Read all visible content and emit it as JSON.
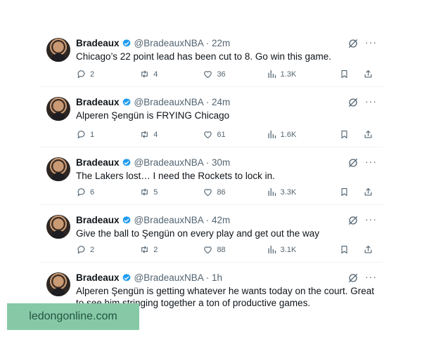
{
  "colors": {
    "verified": "#1d9bf0",
    "muted": "#536471",
    "watermark_bg": "#87c9a7"
  },
  "icons": {
    "reply": "reply-icon",
    "retweet": "retweet-icon",
    "like": "heart-icon",
    "views": "views-icon",
    "bookmark": "bookmark-icon",
    "share": "share-icon",
    "grok": "grok-icon",
    "more": "more-icon",
    "verified": "verified-badge-icon"
  },
  "tweets": [
    {
      "name": "Bradeaux",
      "handle": "@BradeauxNBA",
      "time": "· 22m",
      "text": "Chicago’s 22 point lead has been cut to 8. Go win this game.",
      "replies": "2",
      "retweets": "4",
      "likes": "36",
      "views": "1.3K"
    },
    {
      "name": "Bradeaux",
      "handle": "@BradeauxNBA",
      "time": "· 24m",
      "text": "Alperen Şengün is FRYING Chicago",
      "replies": "1",
      "retweets": "4",
      "likes": "61",
      "views": "1.6K"
    },
    {
      "name": "Bradeaux",
      "handle": "@BradeauxNBA",
      "time": "· 30m",
      "text": "The Lakers lost… I need the Rockets to lock in.",
      "replies": "6",
      "retweets": "5",
      "likes": "86",
      "views": "3.3K"
    },
    {
      "name": "Bradeaux",
      "handle": "@BradeauxNBA",
      "time": "· 42m",
      "text": "Give the ball to Şengün on every play and get out the way",
      "replies": "2",
      "retweets": "2",
      "likes": "88",
      "views": "3.1K"
    },
    {
      "name": "Bradeaux",
      "handle": "@BradeauxNBA",
      "time": "· 1h",
      "text": "Alperen Şengün is getting whatever he wants today on the court. Great to see him stringing together a ton of productive games.",
      "replies": "",
      "retweets": "",
      "likes": "",
      "views": ""
    }
  ],
  "more_glyph": "···",
  "watermark": "ledongonline.com"
}
